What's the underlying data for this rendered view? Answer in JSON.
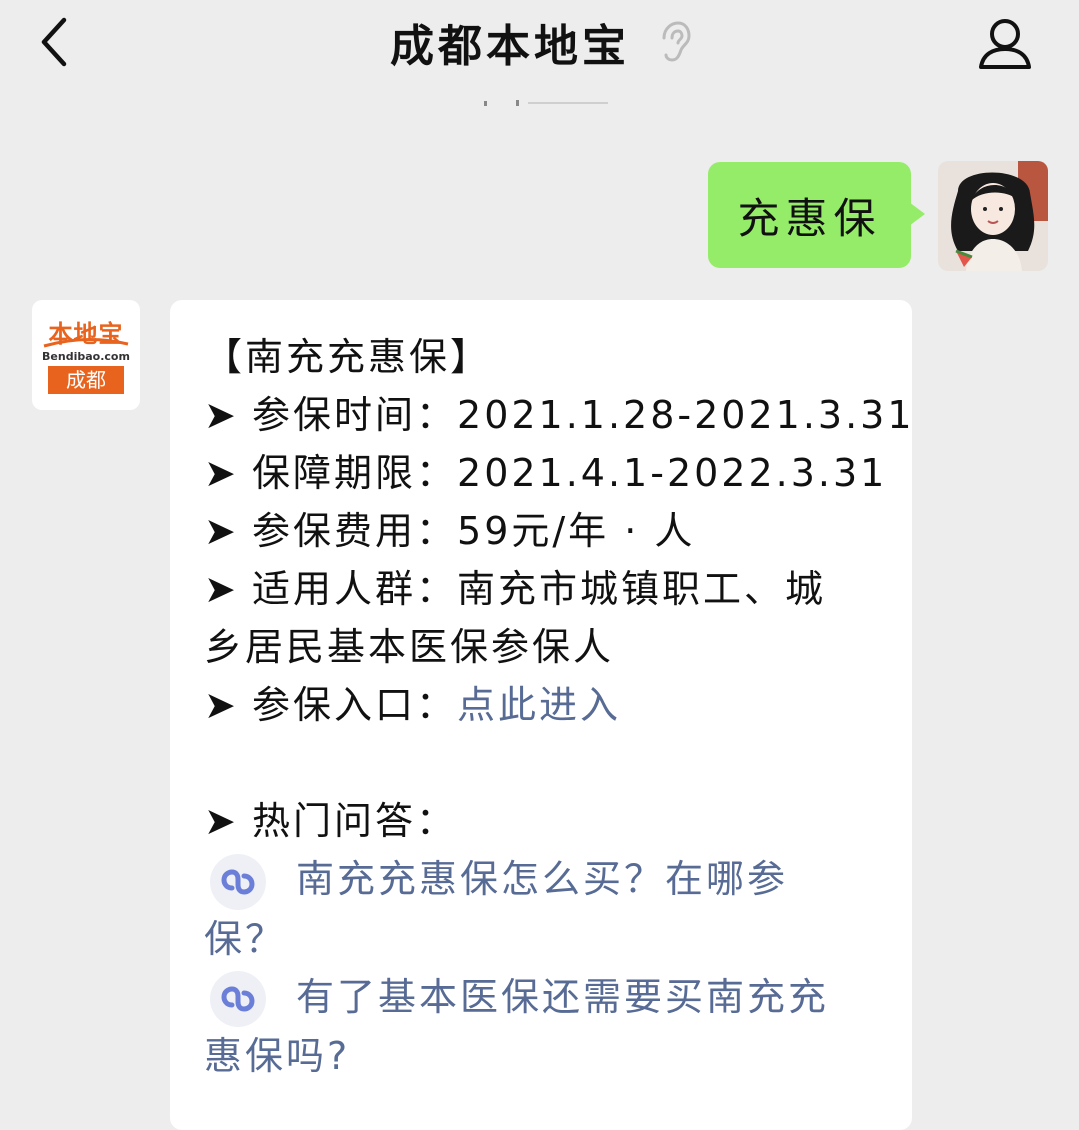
{
  "header": {
    "title": "成都本地宝"
  },
  "user_message": {
    "text": "充惠保"
  },
  "bot_avatar": {
    "logo_text": "本地宝",
    "site": "Bendibao.com",
    "city": "成都"
  },
  "bot_message": {
    "heading": "【南充充惠保】",
    "arrow": "➤",
    "rows": [
      {
        "label": "参保时间：",
        "value": "2021.1.28-2021.3.31"
      },
      {
        "label": "保障期限：",
        "value": "2021.4.1-2022.3.31"
      },
      {
        "label": "参保费用：",
        "value": "59元/年 · 人"
      },
      {
        "label": "适用人群：",
        "value": "南充市城镇职工、城",
        "continuation": "乡居民基本医保参保人"
      }
    ],
    "entry": {
      "label": "参保入口：",
      "link": "点此进入"
    },
    "faq_heading": "热门问答：",
    "faq": [
      {
        "line1": "南充充惠保怎么买？在哪参",
        "line2": "保？"
      },
      {
        "line1": "有了基本医保还需要买南充充",
        "line2": "惠保吗?"
      }
    ]
  },
  "colors": {
    "background": "#ededed",
    "user_bubble": "#95ec69",
    "link": "#576b95",
    "brand_orange": "#e8641e"
  }
}
